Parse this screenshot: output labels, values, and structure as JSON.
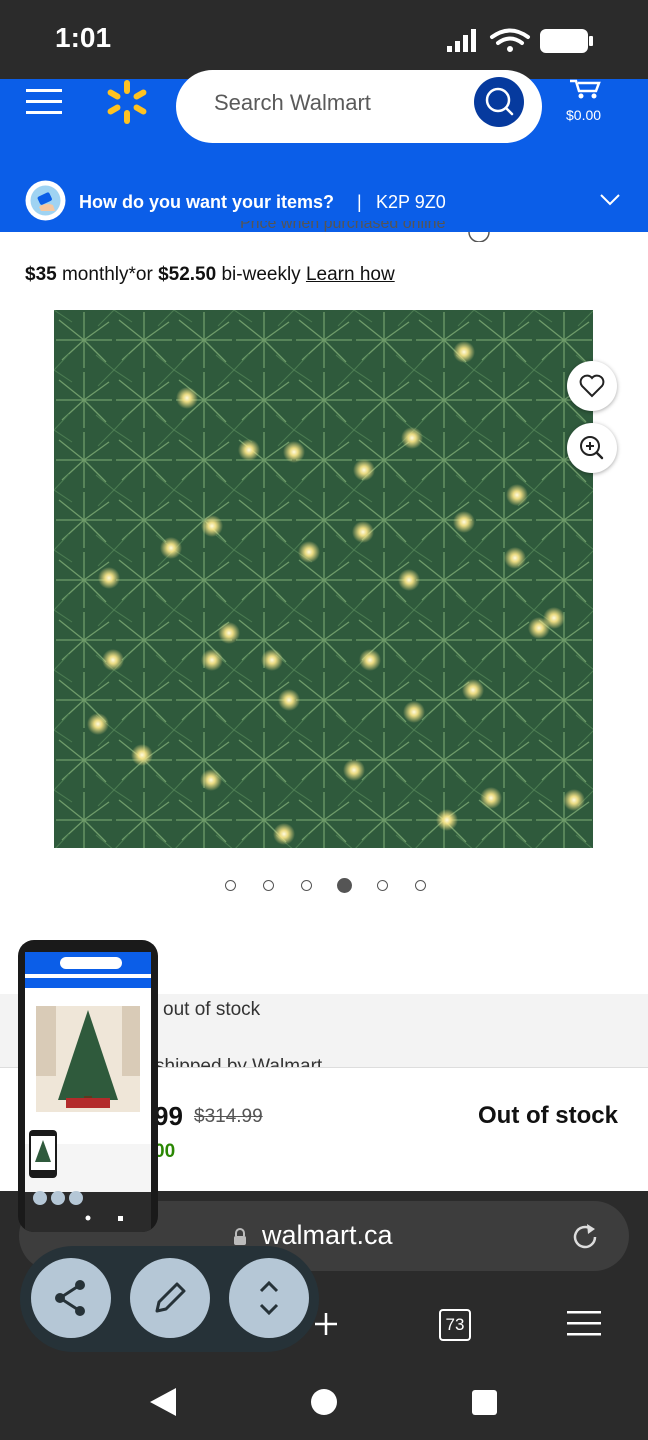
{
  "status_bar": {
    "time": "1:01"
  },
  "header": {
    "search_placeholder": "Search Walmart",
    "cart_amount": "$0.00"
  },
  "delivery": {
    "question": "How do you want your items?",
    "separator": "|",
    "postal_code": "K2P 9Z0"
  },
  "price_note": "Price when purchased online",
  "payments": {
    "monthly_amount": "$35",
    "monthly_label": " monthly*or ",
    "biweekly_amount": "$52.50",
    "biweekly_label": " bi-weekly ",
    "learn_link": "Learn how"
  },
  "carousel": {
    "dot_count": 6,
    "active_index": 3
  },
  "availability": {
    "status": "out of stock",
    "shipped": "shipped by Walmart"
  },
  "price_bar": {
    "current_partial": "99",
    "was_price": "$314.99",
    "savings_partial": "00",
    "stock_label": "Out of stock"
  },
  "browser": {
    "url": "walmart.ca",
    "tab_count": "73"
  },
  "colors": {
    "walmart_blue": "#0b5ee8",
    "spark_yellow": "#ffc220",
    "save_green": "#2a8703"
  }
}
